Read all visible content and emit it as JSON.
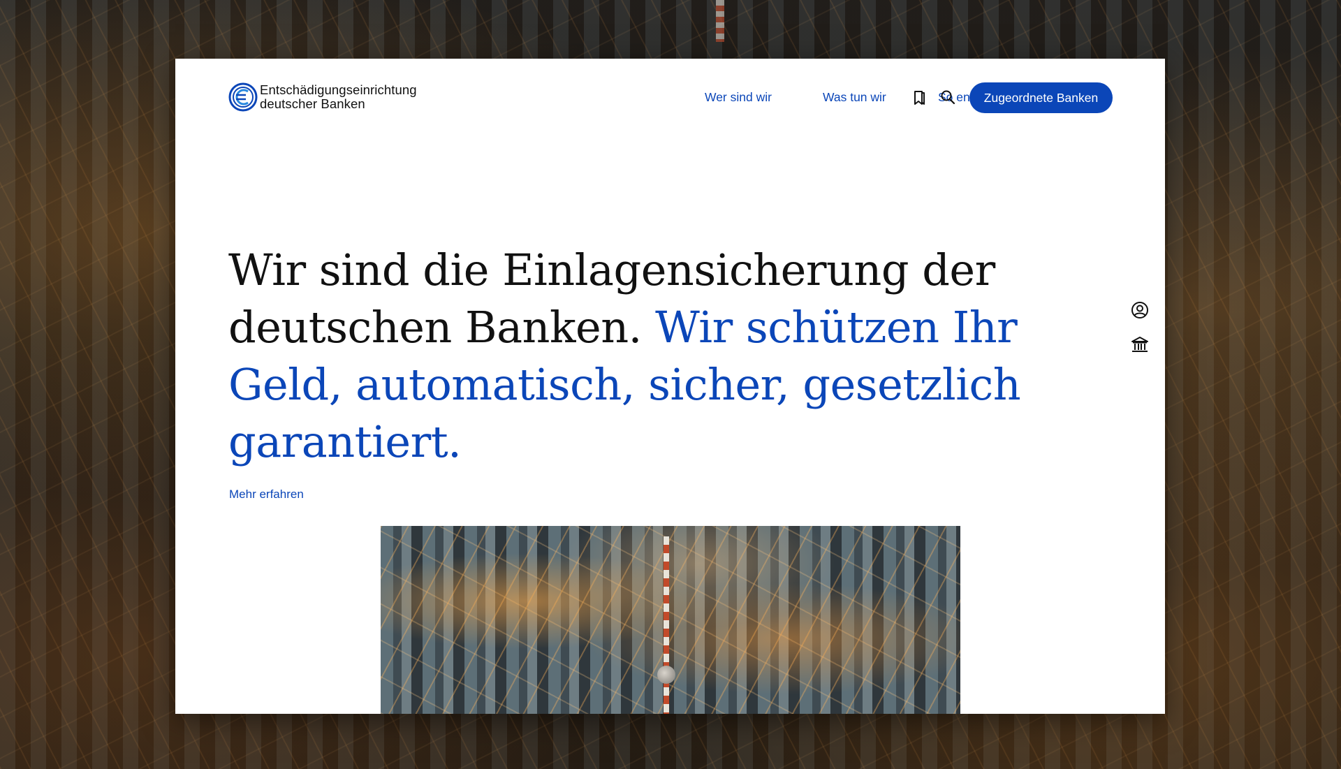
{
  "logo": {
    "line1": "Entschädigungseinrichtung",
    "line2": "deutscher Banken",
    "icon": "euro-coin-icon"
  },
  "nav": {
    "items": [
      {
        "label": "Wer sind wir"
      },
      {
        "label": "Was tun wir"
      },
      {
        "label": "So entschädigen wir"
      }
    ],
    "bookmark_icon": "bookmark-icon",
    "search_icon": "search-icon",
    "cta_label": "Zugeordnete Banken"
  },
  "hero": {
    "text_plain": "Wir sind die Einlagensicherung der deutschen Banken.",
    "text_accent": "Wir schützen Ihr Geld, automatisch, sicher, gesetzlich garantiert.",
    "more_link": "Mehr erfahren"
  },
  "side": {
    "user_icon": "user-circle-icon",
    "bank_icon": "bank-building-icon"
  },
  "colors": {
    "accent": "#0b46b8",
    "text": "#111111",
    "background": "#ffffff"
  }
}
